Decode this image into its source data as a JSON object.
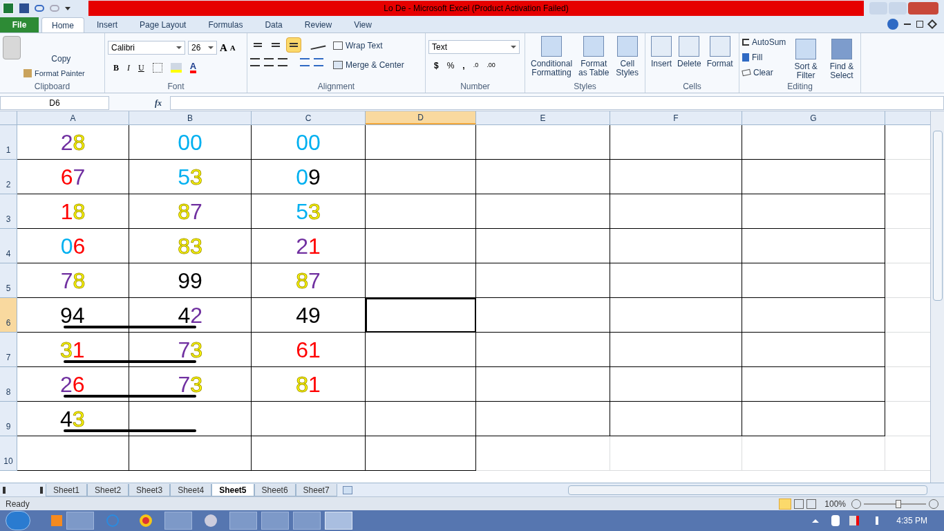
{
  "window": {
    "title": "Lo De  -  Microsoft Excel (Product Activation Failed)"
  },
  "tabs": [
    {
      "label": "File",
      "kind": "file",
      "selected": false
    },
    {
      "label": "Home",
      "kind": "tab",
      "selected": true
    },
    {
      "label": "Insert",
      "kind": "tab",
      "selected": false
    },
    {
      "label": "Page Layout",
      "kind": "tab",
      "selected": false
    },
    {
      "label": "Formulas",
      "kind": "tab",
      "selected": false
    },
    {
      "label": "Data",
      "kind": "tab",
      "selected": false
    },
    {
      "label": "Review",
      "kind": "tab",
      "selected": false
    },
    {
      "label": "View",
      "kind": "tab",
      "selected": false
    }
  ],
  "ribbon": {
    "clipboard": {
      "copy": "Copy",
      "format_painter": "Format Painter",
      "label": "Clipboard"
    },
    "font": {
      "name": "Calibri",
      "size": "26",
      "grow": "A",
      "shrink": "A",
      "bold": "B",
      "italic": "I",
      "underline": "U",
      "font_color": "A",
      "label": "Font"
    },
    "alignment": {
      "vertical": [
        {
          "selected": false
        },
        {
          "selected": false
        },
        {
          "selected": true
        }
      ],
      "wrap": "Wrap Text",
      "merge": "Merge & Center",
      "label": "Alignment"
    },
    "number": {
      "format": "Text",
      "currency": "$",
      "percent": "%",
      "comma": ",",
      "increase_decimal": ".0",
      "decrease_decimal": ".00",
      "label": "Number"
    },
    "styles": {
      "items": [
        "Conditional Formatting",
        "Format as Table",
        "Cell Styles"
      ],
      "label": "Styles"
    },
    "cells": {
      "items": [
        "Insert",
        "Delete",
        "Format"
      ],
      "label": "Cells"
    },
    "editing": {
      "autosum": "AutoSum",
      "fill": "Fill",
      "clear": "Clear",
      "sort": "Sort & Filter",
      "find": "Find & Select",
      "label": "Editing"
    }
  },
  "formula_bar": {
    "name_box": "D6",
    "fx": "fx"
  },
  "columns": [
    {
      "label": "A",
      "selected": false
    },
    {
      "label": "B",
      "selected": false
    },
    {
      "label": "C",
      "selected": false
    },
    {
      "label": "D",
      "selected": true
    },
    {
      "label": "E",
      "selected": false
    },
    {
      "label": "F",
      "selected": false
    },
    {
      "label": "G",
      "selected": false
    }
  ],
  "rows": [
    {
      "header": "1",
      "selected": false,
      "underlined": false,
      "cells": [
        {
          "kind": "center",
          "parts": [
            {
              "text": "2",
              "color": "#7030a0"
            },
            {
              "text": "8",
              "color": "#ffff00"
            }
          ]
        },
        {
          "kind": "center",
          "parts": [
            {
              "text": "00",
              "color": "#00b0f0"
            }
          ]
        },
        {
          "kind": "center",
          "parts": [
            {
              "text": "00",
              "color": "#00b0f0"
            }
          ]
        }
      ]
    },
    {
      "header": "2",
      "selected": false,
      "underlined": false,
      "cells": [
        {
          "kind": "center",
          "parts": [
            {
              "text": "6",
              "color": "#ff0000"
            },
            {
              "text": "7",
              "color": "#7030a0"
            }
          ]
        },
        {
          "kind": "center",
          "parts": [
            {
              "text": "5",
              "color": "#00b0f0"
            },
            {
              "text": "3",
              "color": "#ffff00"
            }
          ]
        },
        {
          "kind": "center",
          "parts": [
            {
              "text": "0",
              "color": "#00b0f0"
            },
            {
              "text": "9",
              "color": "#000000"
            }
          ]
        }
      ]
    },
    {
      "header": "3",
      "selected": false,
      "underlined": false,
      "cells": [
        {
          "kind": "center",
          "parts": [
            {
              "text": "1",
              "color": "#ff0000"
            },
            {
              "text": "8",
              "color": "#ffff00"
            }
          ]
        },
        {
          "kind": "center",
          "parts": [
            {
              "text": "8",
              "color": "#ffff00"
            },
            {
              "text": "7",
              "color": "#7030a0"
            }
          ]
        },
        {
          "kind": "center",
          "parts": [
            {
              "text": "5",
              "color": "#00b0f0"
            },
            {
              "text": "3",
              "color": "#ffff00"
            }
          ]
        }
      ]
    },
    {
      "header": "4",
      "selected": false,
      "underlined": false,
      "cells": [
        {
          "kind": "center",
          "parts": [
            {
              "text": "0",
              "color": "#00b0f0"
            },
            {
              "text": "6",
              "color": "#ff0000"
            }
          ]
        },
        {
          "kind": "center",
          "parts": [
            {
              "text": "83",
              "color": "#ffff00"
            }
          ]
        },
        {
          "kind": "center",
          "parts": [
            {
              "text": "2",
              "color": "#7030a0"
            },
            {
              "text": "1",
              "color": "#ff0000"
            }
          ]
        }
      ]
    },
    {
      "header": "5",
      "selected": false,
      "underlined": false,
      "cells": [
        {
          "kind": "center",
          "parts": [
            {
              "text": "7",
              "color": "#7030a0"
            },
            {
              "text": "8",
              "color": "#ffff00"
            }
          ]
        },
        {
          "kind": "center",
          "parts": [
            {
              "text": "99",
              "color": "#000000"
            }
          ]
        },
        {
          "kind": "center",
          "parts": [
            {
              "text": "8",
              "color": "#ffff00"
            },
            {
              "text": "7",
              "color": "#7030a0"
            }
          ]
        }
      ]
    },
    {
      "header": "6",
      "selected": true,
      "underlined": true,
      "cells": [
        {
          "kind": "left",
          "parts": [
            {
              "text": "94",
              "color": "#000000"
            }
          ]
        },
        {
          "kind": "right",
          "parts": [
            {
              "text": "4",
              "color": "#000000"
            },
            {
              "text": "2",
              "color": "#7030a0"
            }
          ]
        },
        {
          "kind": "center",
          "parts": [
            {
              "text": "49",
              "color": "#000000"
            }
          ]
        }
      ]
    },
    {
      "header": "7",
      "selected": false,
      "underlined": true,
      "cells": [
        {
          "kind": "left",
          "parts": [
            {
              "text": "3",
              "color": "#ffff00"
            },
            {
              "text": "1",
              "color": "#ff0000"
            }
          ]
        },
        {
          "kind": "right",
          "parts": [
            {
              "text": "7",
              "color": "#7030a0"
            },
            {
              "text": "3",
              "color": "#ffff00"
            }
          ]
        },
        {
          "kind": "center",
          "parts": [
            {
              "text": "61",
              "color": "#ff0000"
            }
          ]
        }
      ]
    },
    {
      "header": "8",
      "selected": false,
      "underlined": true,
      "cells": [
        {
          "kind": "left",
          "parts": [
            {
              "text": "2",
              "color": "#7030a0"
            },
            {
              "text": "6",
              "color": "#ff0000"
            }
          ]
        },
        {
          "kind": "right",
          "parts": [
            {
              "text": "7",
              "color": "#7030a0"
            },
            {
              "text": "3",
              "color": "#ffff00"
            }
          ]
        },
        {
          "kind": "center",
          "parts": [
            {
              "text": "8",
              "color": "#ffff00"
            },
            {
              "text": "1",
              "color": "#ff0000"
            }
          ]
        }
      ]
    },
    {
      "header": "9",
      "selected": false,
      "underlined": true,
      "cells": [
        {
          "kind": "left",
          "parts": [
            {
              "text": "4",
              "color": "#000000"
            },
            {
              "text": "3",
              "color": "#ffff00"
            }
          ]
        }
      ]
    },
    {
      "header": "10",
      "selected": false,
      "underlined": false,
      "cells": []
    }
  ],
  "sheets": [
    {
      "label": "Sheet1",
      "selected": false
    },
    {
      "label": "Sheet2",
      "selected": false
    },
    {
      "label": "Sheet3",
      "selected": false
    },
    {
      "label": "Sheet4",
      "selected": false
    },
    {
      "label": "Sheet5",
      "selected": true
    },
    {
      "label": "Sheet6",
      "selected": false
    },
    {
      "label": "Sheet7",
      "selected": false
    }
  ],
  "status_bar": {
    "status": "Ready",
    "zoom": "100%",
    "zoom_level": {
      "level": 0.55
    }
  },
  "taskbar": {
    "time": "4:35 PM"
  }
}
